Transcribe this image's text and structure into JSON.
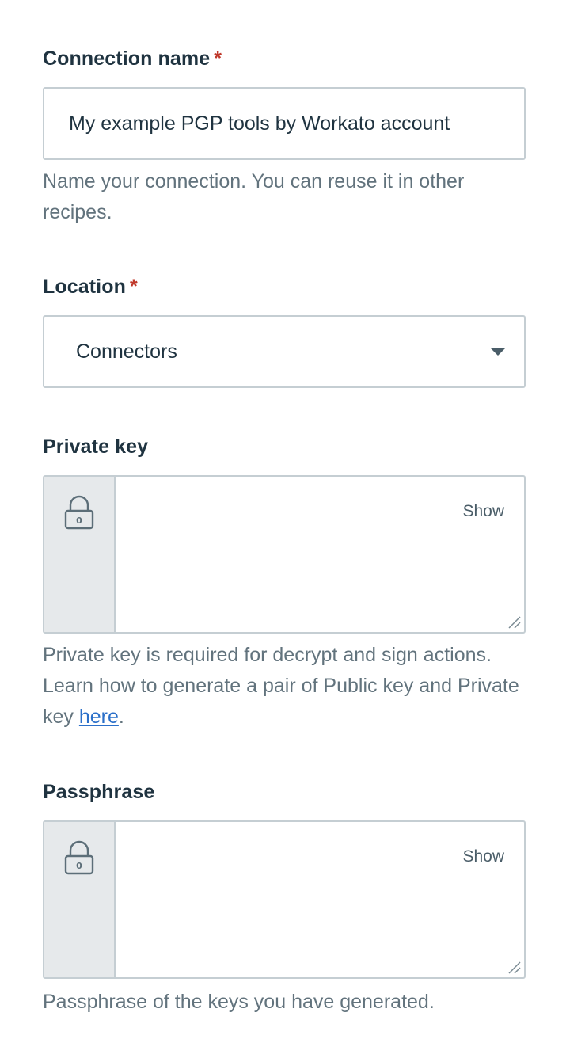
{
  "connection_name": {
    "label": "Connection name",
    "required_marker": "*",
    "value": "My example PGP tools by Workato account",
    "hint": "Name your connection. You can reuse it in other recipes."
  },
  "location": {
    "label": "Location",
    "required_marker": "*",
    "selected": "Connectors"
  },
  "private_key": {
    "label": "Private key",
    "show_label": "Show",
    "hint_prefix": "Private key is required for decrypt and sign actions. Learn how to generate a pair of Public key and Private key ",
    "hint_link": "here",
    "hint_suffix": "."
  },
  "passphrase": {
    "label": "Passphrase",
    "show_label": "Show",
    "hint": "Passphrase of the keys you have generated."
  },
  "colors": {
    "required": "#c0392b",
    "link": "#2a6fc9",
    "border": "#c5ced3",
    "lock_pane": "#e6e9eb"
  }
}
